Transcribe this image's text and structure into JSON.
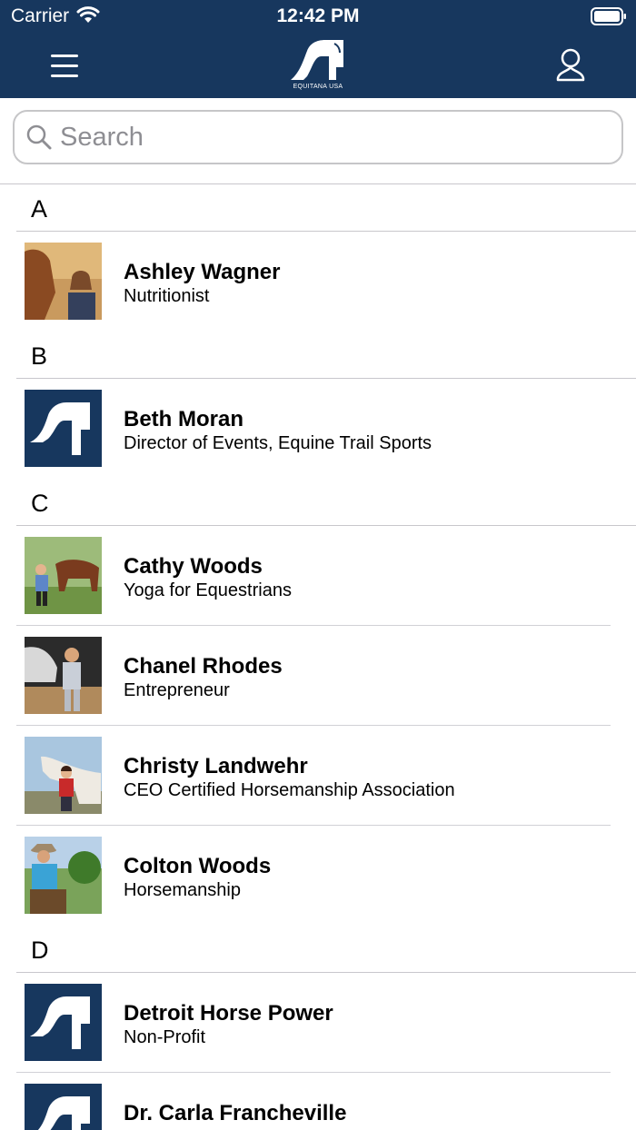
{
  "status_bar": {
    "carrier": "Carrier",
    "time": "12:42 PM"
  },
  "nav": {
    "logo_text": "EQUITANA USA"
  },
  "search": {
    "placeholder": "Search"
  },
  "colors": {
    "brand": "#17375e",
    "separator": "#d1d1d6"
  },
  "sections": [
    {
      "letter": "A",
      "items": [
        {
          "name": "Ashley Wagner",
          "subtitle": "Nutritionist",
          "thumb": "photo-woman-with-horse"
        }
      ]
    },
    {
      "letter": "B",
      "items": [
        {
          "name": "Beth Moran",
          "subtitle": "Director of Events, Equine Trail Sports",
          "thumb": "equitana-logo"
        }
      ]
    },
    {
      "letter": "C",
      "items": [
        {
          "name": "Cathy Woods",
          "subtitle": "Yoga for Equestrians",
          "thumb": "photo-woman-with-horses"
        },
        {
          "name": "Chanel Rhodes",
          "subtitle": "Entrepreneur",
          "thumb": "photo-woman-rider"
        },
        {
          "name": "Christy Landwehr",
          "subtitle": "CEO Certified Horsemanship Association",
          "thumb": "photo-woman-white-horse"
        },
        {
          "name": "Colton Woods",
          "subtitle": "Horsemanship",
          "thumb": "photo-cowboy"
        }
      ]
    },
    {
      "letter": "D",
      "items": [
        {
          "name": "Detroit Horse Power",
          "subtitle": "Non-Profit",
          "thumb": "equitana-logo"
        },
        {
          "name": "Dr. Carla Francheville",
          "subtitle": "",
          "thumb": "equitana-logo"
        }
      ]
    }
  ]
}
